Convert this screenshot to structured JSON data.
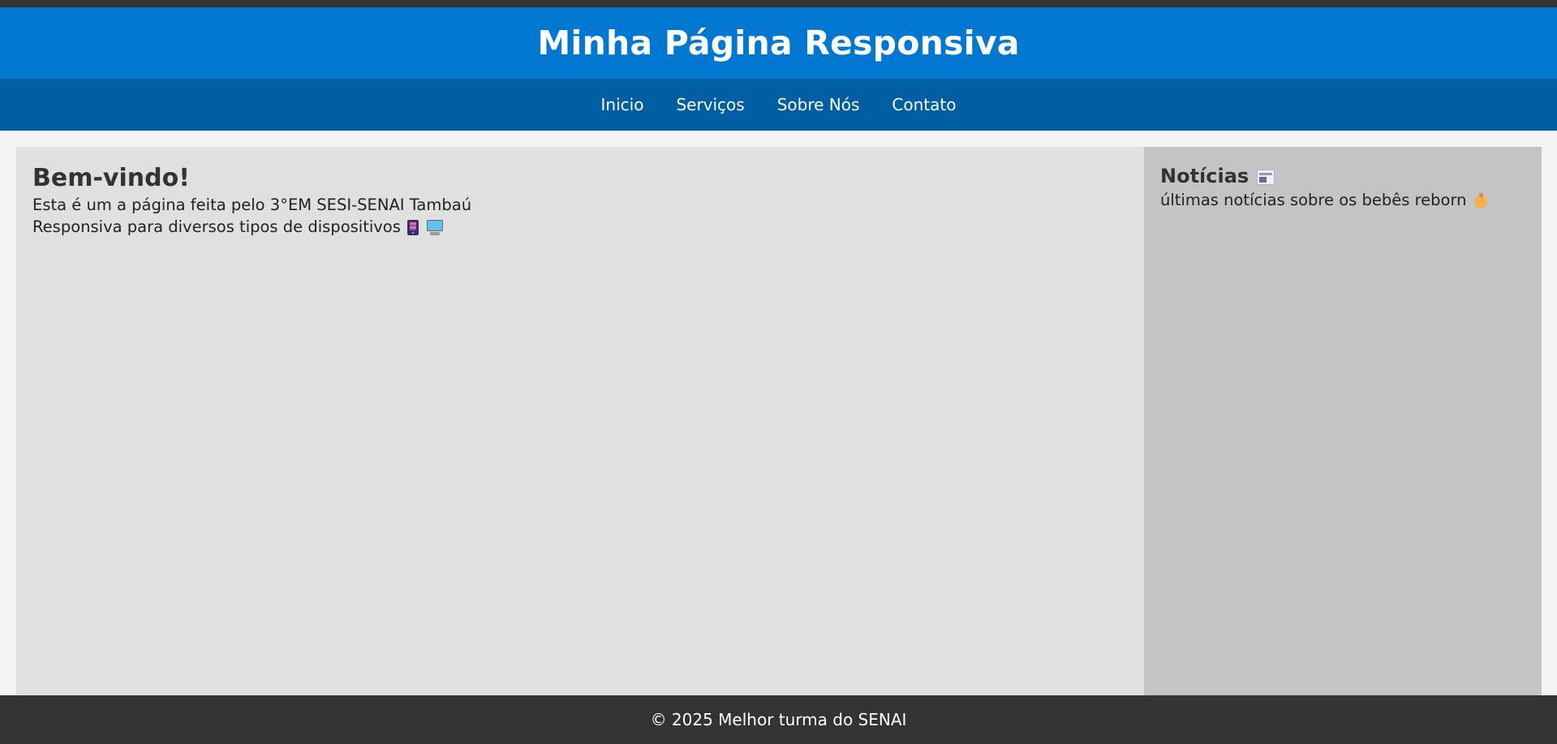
{
  "header": {
    "title": "Minha Página Responsiva"
  },
  "nav": {
    "items": [
      {
        "label": "Inicio"
      },
      {
        "label": "Serviços"
      },
      {
        "label": "Sobre Nós"
      },
      {
        "label": "Contato"
      }
    ]
  },
  "main": {
    "heading": "Bem-vindo!",
    "line1": "Esta é um a página feita pelo 3°EM SESI-SENAI Tambaú",
    "line2": "Responsiva para diversos tipos de dispositivos",
    "line2_icons": [
      "tablet-icon",
      "desktop-computer-icon"
    ]
  },
  "aside": {
    "heading": "Notícias",
    "heading_icon": "newspaper-icon",
    "text": "últimas notícias sobre os bebês reborn",
    "text_icon": "baby-icon"
  },
  "footer": {
    "text": "© 2025 Melhor turma do SENAI"
  },
  "colors": {
    "header_bg": "#0077d1",
    "nav_bg": "#005ea3",
    "main_bg": "#e0e0e0",
    "aside_bg": "#c4c4c4",
    "footer_bg": "#333333",
    "page_bg": "#f4f4f4"
  }
}
